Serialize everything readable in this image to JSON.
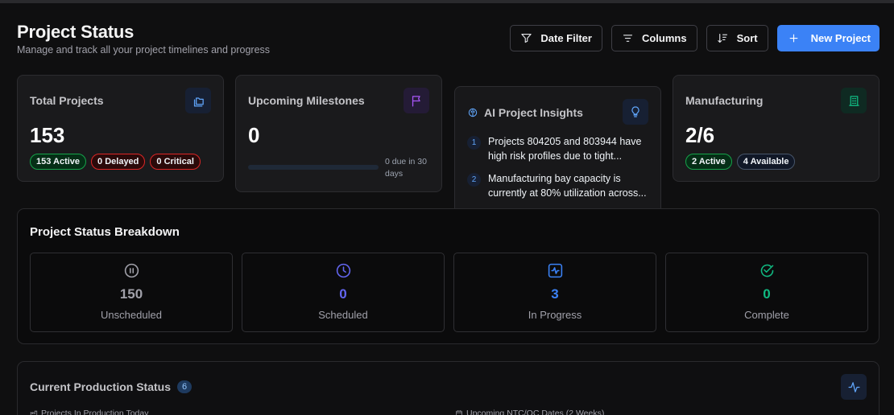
{
  "header": {
    "title": "Project Status",
    "subtitle": "Manage and track all your project timelines and progress"
  },
  "toolbar": {
    "date_filter": "Date Filter",
    "columns": "Columns",
    "sort": "Sort",
    "new_project": "New Project"
  },
  "cards": {
    "total": {
      "title": "Total Projects",
      "value": "153",
      "badges": [
        "153 Active",
        "0 Delayed",
        "0 Critical"
      ],
      "icon": "folders-icon"
    },
    "milestones": {
      "title": "Upcoming Milestones",
      "value": "0",
      "progress": 0,
      "due_text": "0 due in 30 days",
      "icon": "flag-icon"
    },
    "ai": {
      "title": "AI Project Insights",
      "insights": [
        {
          "num": "1",
          "text": "Projects 804205 and 803944 have high risk profiles due to tight..."
        },
        {
          "num": "2",
          "text": "Manufacturing bay capacity is currently at 80% utilization across..."
        }
      ],
      "icon": "lightbulb-icon"
    },
    "manufacturing": {
      "title": "Manufacturing",
      "value": "2/6",
      "badges": [
        "2 Active",
        "4 Available"
      ],
      "icon": "building-icon"
    }
  },
  "breakdown": {
    "title": "Project Status Breakdown",
    "items": [
      {
        "value": "150",
        "label": "Unscheduled",
        "color": "#a1a1aa",
        "icon": "pause-circle-icon"
      },
      {
        "value": "0",
        "label": "Scheduled",
        "color": "#6366f1",
        "icon": "clock-icon"
      },
      {
        "value": "3",
        "label": "In Progress",
        "color": "#3b82f6",
        "icon": "activity-square-icon"
      },
      {
        "value": "0",
        "label": "Complete",
        "color": "#10b981",
        "icon": "check-circle-icon"
      }
    ]
  },
  "production": {
    "title": "Current Production Status",
    "count": "6",
    "left_heading": "Projects In Production Today",
    "right_heading": "Upcoming NTC/QC Dates (2 Weeks)",
    "icon": "activity-icon"
  }
}
